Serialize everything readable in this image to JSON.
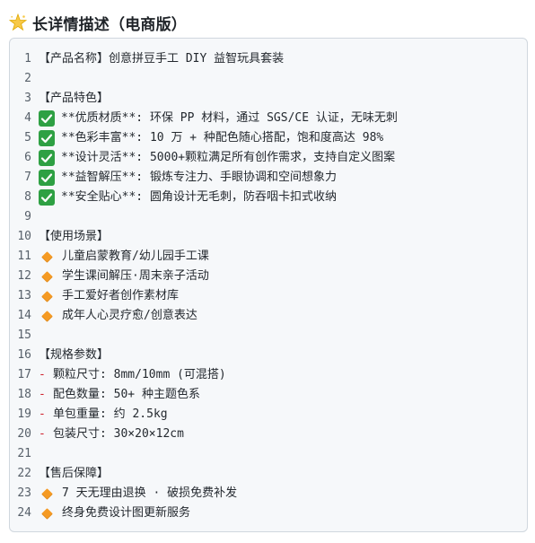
{
  "header": {
    "icon": "sparkle-star-icon",
    "title": "长详情描述（电商版）"
  },
  "colors": {
    "check_bg": "#2ea043",
    "diamond": "#f59a23",
    "dash": "#cf222e",
    "line_number": "#57606a",
    "box_bg": "#f6f8fa",
    "box_border": "#d0d7de"
  },
  "lines": [
    {
      "n": "1",
      "bullet": "none",
      "text": "【产品名称】创意拼豆手工 DIY 益智玩具套装"
    },
    {
      "n": "2",
      "bullet": "none",
      "text": ""
    },
    {
      "n": "3",
      "bullet": "none",
      "text": "【产品特色】"
    },
    {
      "n": "4",
      "bullet": "check",
      "text": "**优质材质**: 环保 PP 材料，通过 SGS/CE 认证，无味无刺"
    },
    {
      "n": "5",
      "bullet": "check",
      "text": "**色彩丰富**: 10 万 + 种配色随心搭配，饱和度高达 98%"
    },
    {
      "n": "6",
      "bullet": "check",
      "text": "**设计灵活**: 5000+颗粒满足所有创作需求，支持自定义图案"
    },
    {
      "n": "7",
      "bullet": "check",
      "text": "**益智解压**: 锻炼专注力、手眼协调和空间想象力"
    },
    {
      "n": "8",
      "bullet": "check",
      "text": "**安全贴心**: 圆角设计无毛刺，防吞咽卡扣式收纳"
    },
    {
      "n": "9",
      "bullet": "none",
      "text": ""
    },
    {
      "n": "10",
      "bullet": "none",
      "text": "【使用场景】"
    },
    {
      "n": "11",
      "bullet": "diamond",
      "text": "儿童启蒙教育/幼儿园手工课"
    },
    {
      "n": "12",
      "bullet": "diamond",
      "text": "学生课间解压·周末亲子活动"
    },
    {
      "n": "13",
      "bullet": "diamond",
      "text": "手工爱好者创作素材库"
    },
    {
      "n": "14",
      "bullet": "diamond",
      "text": "成年人心灵疗愈/创意表达"
    },
    {
      "n": "15",
      "bullet": "none",
      "text": ""
    },
    {
      "n": "16",
      "bullet": "none",
      "text": "【规格参数】"
    },
    {
      "n": "17",
      "bullet": "dash",
      "text": "颗粒尺寸: 8mm/10mm (可混搭)"
    },
    {
      "n": "18",
      "bullet": "dash",
      "text": "配色数量: 50+ 种主题色系"
    },
    {
      "n": "19",
      "bullet": "dash",
      "text": "单包重量: 约 2.5kg"
    },
    {
      "n": "20",
      "bullet": "dash",
      "text": "包装尺寸: 30×20×12cm"
    },
    {
      "n": "21",
      "bullet": "none",
      "text": ""
    },
    {
      "n": "22",
      "bullet": "none",
      "text": "【售后保障】"
    },
    {
      "n": "23",
      "bullet": "diamond",
      "text": "7 天无理由退换 · 破损免费补发"
    },
    {
      "n": "24",
      "bullet": "diamond",
      "text": "终身免费设计图更新服务"
    }
  ]
}
